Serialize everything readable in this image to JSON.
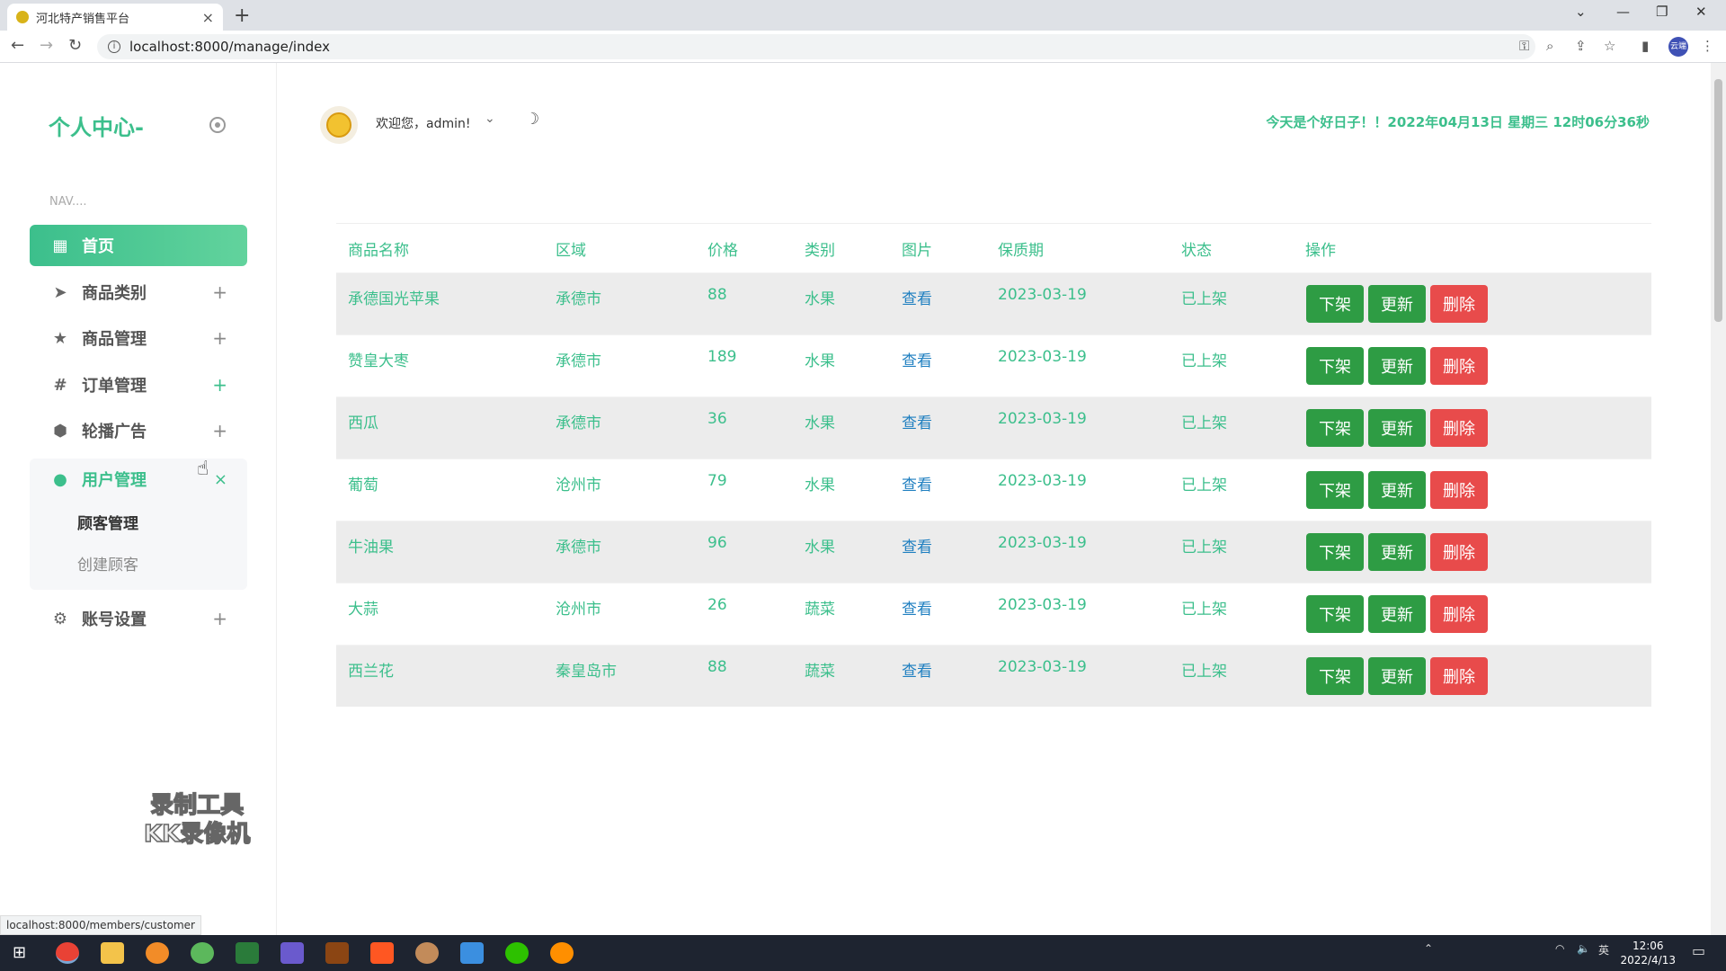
{
  "browser": {
    "tab_title": "河北特产销售平台",
    "url": "localhost:8000/manage/index",
    "status_url": "localhost:8000/members/customer",
    "profile_label": "云端"
  },
  "sidebar": {
    "brand": "个人中心-",
    "nav_header": "NAV....",
    "items": [
      {
        "label": "首页",
        "icon": "dashboard-icon"
      },
      {
        "label": "商品类别",
        "icon": "paper-plane-icon"
      },
      {
        "label": "商品管理",
        "icon": "star-icon"
      },
      {
        "label": "订单管理",
        "icon": "hash-icon"
      },
      {
        "label": "轮播广告",
        "icon": "box-icon"
      },
      {
        "label": "用户管理",
        "icon": "user-icon"
      },
      {
        "label": "账号设置",
        "icon": "gear-icon"
      }
    ],
    "user_submenu": [
      "顾客管理",
      "创建顾客"
    ]
  },
  "header": {
    "welcome": "欢迎您，admin!",
    "datetime": "今天是个好日子！！2022年04月13日 星期三 12时06分36秒"
  },
  "table": {
    "columns": [
      "商品名称",
      "区域",
      "价格",
      "类别",
      "图片",
      "保质期",
      "状态",
      "操作"
    ],
    "rows": [
      {
        "name": "承德国光苹果",
        "region": "承德市",
        "price": "88",
        "category": "水果",
        "image": "查看",
        "expiry": "2023-03-19",
        "status": "已上架"
      },
      {
        "name": "赞皇大枣",
        "region": "承德市",
        "price": "189",
        "category": "水果",
        "image": "查看",
        "expiry": "2023-03-19",
        "status": "已上架"
      },
      {
        "name": "西瓜",
        "region": "承德市",
        "price": "36",
        "category": "水果",
        "image": "查看",
        "expiry": "2023-03-19",
        "status": "已上架"
      },
      {
        "name": "葡萄",
        "region": "沧州市",
        "price": "79",
        "category": "水果",
        "image": "查看",
        "expiry": "2023-03-19",
        "status": "已上架"
      },
      {
        "name": "牛油果",
        "region": "承德市",
        "price": "96",
        "category": "水果",
        "image": "查看",
        "expiry": "2023-03-19",
        "status": "已上架"
      },
      {
        "name": "大蒜",
        "region": "沧州市",
        "price": "26",
        "category": "蔬菜",
        "image": "查看",
        "expiry": "2023-03-19",
        "status": "已上架"
      },
      {
        "name": "西兰花",
        "region": "秦皇岛市",
        "price": "88",
        "category": "蔬菜",
        "image": "查看",
        "expiry": "2023-03-19",
        "status": "已上架"
      }
    ],
    "actions": {
      "unlist": "下架",
      "update": "更新",
      "delete": "删除"
    }
  },
  "watermark": [
    "录制工具",
    "KK录像机"
  ],
  "taskbar": {
    "time": "12:06",
    "date": "2022/4/13",
    "ime": "英"
  },
  "colors": {
    "accent": "#3cbf8c",
    "green_button": "#2e9c44",
    "red_button": "#e84b4b",
    "link": "#1f7fc0"
  }
}
